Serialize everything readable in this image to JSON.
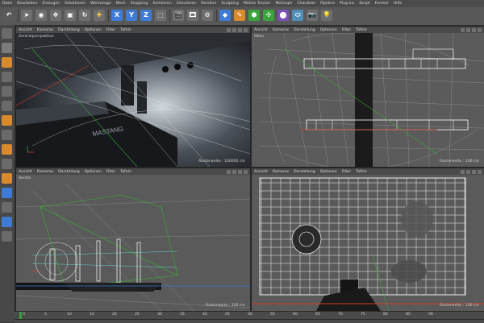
{
  "menu": [
    "Datei",
    "Bearbeiten",
    "Erzeugen",
    "Selektieren",
    "Werkzeuge",
    "Mesh",
    "Snapping",
    "Animieren",
    "Simulieren",
    "Rendern",
    "Sculpting",
    "Motion Tracker",
    "MoGraph",
    "Charakter",
    "Pipeline",
    "Plug-ins",
    "Skript",
    "Fenster",
    "Hilfe"
  ],
  "toolbar": {
    "axis_x": "X",
    "axis_y": "Y",
    "axis_z": "Z"
  },
  "viewport_menu": [
    "Ansicht",
    "Kameras",
    "Darstellung",
    "Optionen",
    "Filter",
    "Tafeln"
  ],
  "viewports": {
    "perspective": {
      "name": "Zentralperspektive",
      "grid": "Rasterweite : 100000 cm"
    },
    "top": {
      "name": "Oben",
      "grid": "Rasterweite : 100 cm"
    },
    "right": {
      "name": "Rechts",
      "grid": "Rasterweite : 100 cm"
    },
    "front": {
      "name": "",
      "grid": "Rasterweite : 100 cm"
    }
  },
  "timeline": {
    "ticks": [
      "0",
      "5",
      "10",
      "15",
      "20",
      "25",
      "30",
      "35",
      "40",
      "45",
      "50",
      "55",
      "60",
      "65",
      "70",
      "75",
      "80",
      "85",
      "90"
    ]
  },
  "colors": {
    "accent": "#3d7bd6",
    "bg": "#3a3a3a",
    "axis_red": "#d23a2a",
    "axis_green": "#3aa33a"
  }
}
